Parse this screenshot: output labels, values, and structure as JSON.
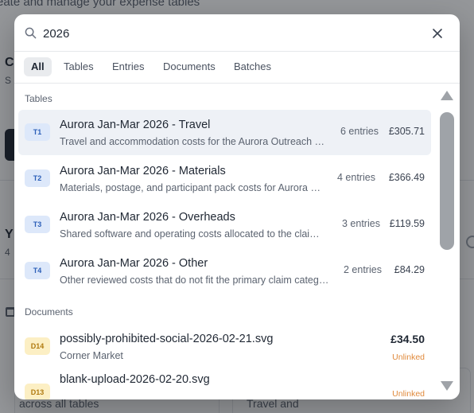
{
  "background": {
    "top_text": "eate and manage your expense tables",
    "heading_c": "C",
    "sub_s": "S",
    "heading_y": "Y",
    "sub_4": "4",
    "card_left_text": "across all tables",
    "card_right_text": "Travel and"
  },
  "search": {
    "value": "2026",
    "placeholder": "Search"
  },
  "tabs": [
    {
      "label": "All",
      "active": true
    },
    {
      "label": "Tables",
      "active": false
    },
    {
      "label": "Entries",
      "active": false
    },
    {
      "label": "Documents",
      "active": false
    },
    {
      "label": "Batches",
      "active": false
    }
  ],
  "sections": {
    "tables_title": "Tables",
    "documents_title": "Documents"
  },
  "tables": [
    {
      "badge": "T1",
      "title": "Aurora Jan-Mar 2026 - Travel",
      "subtitle": "Travel and accommodation costs for the Aurora Outreach Programme",
      "count": "6 entries",
      "amount": "£305.71",
      "highlighted": true
    },
    {
      "badge": "T2",
      "title": "Aurora Jan-Mar 2026 - Materials",
      "subtitle": "Materials, postage, and participant pack costs for Aurora Outreach",
      "count": "4 entries",
      "amount": "£366.49",
      "highlighted": false
    },
    {
      "badge": "T3",
      "title": "Aurora Jan-Mar 2026 - Overheads",
      "subtitle": "Shared software and operating costs allocated to the claim period",
      "count": "3 entries",
      "amount": "£119.59",
      "highlighted": false
    },
    {
      "badge": "T4",
      "title": "Aurora Jan-Mar 2026 - Other",
      "subtitle": "Other reviewed costs that do not fit the primary claim categories",
      "count": "2 entries",
      "amount": "£84.29",
      "highlighted": false
    }
  ],
  "documents": [
    {
      "badge": "D14",
      "title": "possibly-prohibited-social-2026-02-21.svg",
      "subtitle": "Corner Market",
      "amount": "£34.50",
      "status": "Unlinked"
    },
    {
      "badge": "D13",
      "title": "blank-upload-2026-02-20.svg",
      "subtitle": "",
      "amount": "",
      "status": "Unlinked"
    }
  ],
  "colors": {
    "accent_blue": "#2c5fb8",
    "doc_badge": "#b07a10",
    "unlinked": "#e08a3c"
  },
  "icons": {
    "search": "search-icon",
    "close": "close-icon",
    "scroll_up": "scroll-up-arrow-icon",
    "scroll_down": "scroll-down-arrow-icon"
  }
}
